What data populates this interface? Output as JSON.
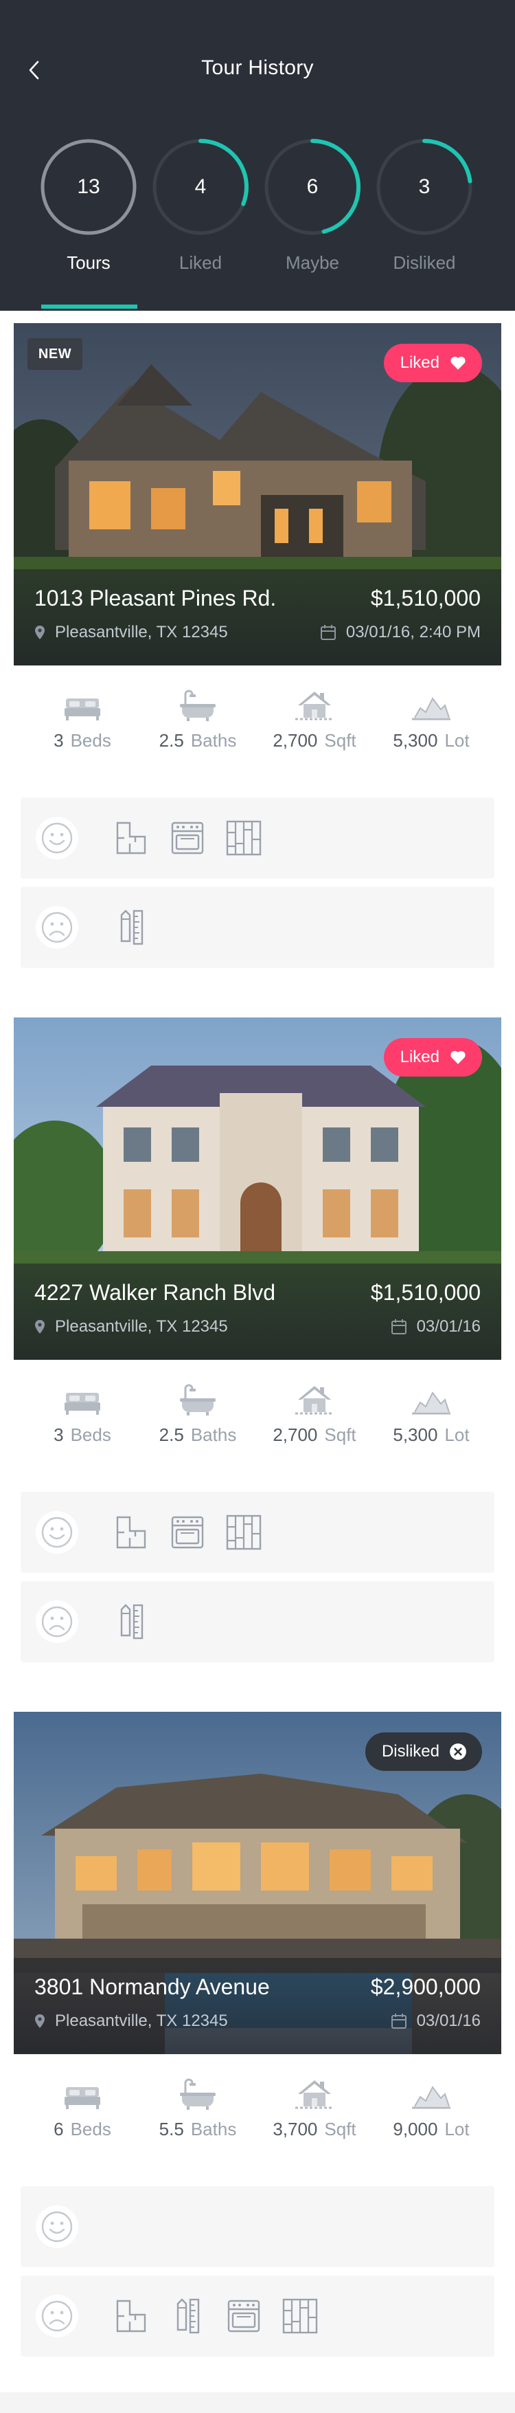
{
  "header": {
    "title": "Tour History",
    "tabs": [
      {
        "count": "13",
        "label": "Tours",
        "progress": 0,
        "active": true
      },
      {
        "count": "4",
        "label": "Liked",
        "progress": 0.31
      },
      {
        "count": "6",
        "label": "Maybe",
        "progress": 0.46
      },
      {
        "count": "3",
        "label": "Disliked",
        "progress": 0.23
      }
    ]
  },
  "colors": {
    "header_bg": "#2b3038",
    "accent": "#1fc5b0",
    "liked": "#fe3d6c",
    "disliked_pill": "#30343b",
    "icon_gray": "#b6bcc4"
  },
  "listings": [
    {
      "badge": "NEW",
      "status": "Liked",
      "status_icon": "heart-icon",
      "address": "1013 Pleasant Pines Rd.",
      "price": "$1,510,000",
      "city": "Pleasantville, TX 12345",
      "date": "03/01/16, 2:40 PM",
      "specs": [
        {
          "value": "3",
          "unit": "Beds",
          "icon": "bed-icon"
        },
        {
          "value": "2.5",
          "unit": "Baths",
          "icon": "bathtub-icon"
        },
        {
          "value": "2,700",
          "unit": "Sqft",
          "icon": "house-icon"
        },
        {
          "value": "5,300",
          "unit": "Lot",
          "icon": "lot-icon"
        }
      ],
      "likes": [
        "floorplan-icon",
        "stove-icon",
        "flooring-icon"
      ],
      "dislikes": [
        "pencil-ruler-icon"
      ]
    },
    {
      "badge": "",
      "status": "Liked",
      "status_icon": "heart-icon",
      "address": "4227 Walker Ranch Blvd",
      "price": "$1,510,000",
      "city": "Pleasantville, TX 12345",
      "date": "03/01/16",
      "specs": [
        {
          "value": "3",
          "unit": "Beds",
          "icon": "bed-icon"
        },
        {
          "value": "2.5",
          "unit": "Baths",
          "icon": "bathtub-icon"
        },
        {
          "value": "2,700",
          "unit": "Sqft",
          "icon": "house-icon"
        },
        {
          "value": "5,300",
          "unit": "Lot",
          "icon": "lot-icon"
        }
      ],
      "likes": [
        "floorplan-icon",
        "stove-icon",
        "flooring-icon"
      ],
      "dislikes": [
        "pencil-ruler-icon"
      ]
    },
    {
      "badge": "",
      "status": "Disliked",
      "status_icon": "close-circle-icon",
      "address": "3801 Normandy Avenue",
      "price": "$2,900,000",
      "city": "Pleasantville, TX 12345",
      "date": "03/01/16",
      "specs": [
        {
          "value": "6",
          "unit": "Beds",
          "icon": "bed-icon"
        },
        {
          "value": "5.5",
          "unit": "Baths",
          "icon": "bathtub-icon"
        },
        {
          "value": "3,700",
          "unit": "Sqft",
          "icon": "house-icon"
        },
        {
          "value": "9,000",
          "unit": "Lot",
          "icon": "lot-icon"
        }
      ],
      "likes": [],
      "dislikes": [
        "floorplan-icon",
        "pencil-ruler-icon",
        "stove-icon",
        "flooring-icon"
      ]
    }
  ]
}
